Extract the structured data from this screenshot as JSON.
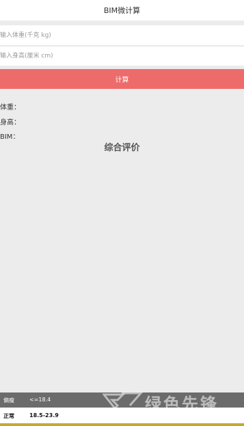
{
  "navbar": {
    "title": "BIM微计算"
  },
  "form": {
    "weight_placeholder": "输入体重(千克 kg)",
    "height_placeholder": "输入身高(厘米 cm)",
    "calculate_label": "计算"
  },
  "results": {
    "weight_label": "体重：",
    "height_label": "身高：",
    "bmi_label": "BIM："
  },
  "evaluation": {
    "title": "综合评价"
  },
  "bmi_table": {
    "rows": [
      {
        "name": "偏瘦",
        "range": "<=18.4"
      },
      {
        "name": "正常",
        "range": "18.5-23.9"
      }
    ]
  },
  "watermark": {
    "text": "绿色先锋"
  },
  "colors": {
    "accent": "#ee6b6b",
    "page_background": "#ececec",
    "underweight_row": "#6b6b6b",
    "bottom_strip": "#c8a72c"
  }
}
